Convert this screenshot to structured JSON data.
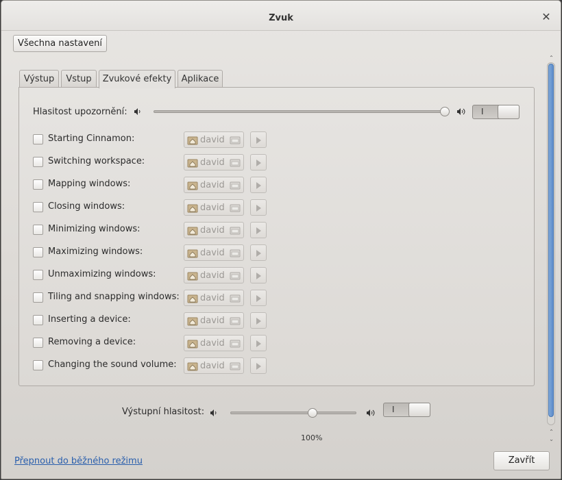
{
  "window": {
    "title": "Zvuk"
  },
  "toolbar": {
    "all_settings_label": "Všechna nastavení"
  },
  "tabs": [
    {
      "label": "Výstup"
    },
    {
      "label": "Vstup"
    },
    {
      "label": "Zvukové efekty"
    },
    {
      "label": "Aplikace"
    }
  ],
  "active_tab": "Zvukové efekty",
  "alert": {
    "label": "Hlasitost upozornění:",
    "level": 1.0,
    "toggle_text": "I",
    "enabled": true
  },
  "effects": [
    {
      "label": "Starting Cinnamon:",
      "file": "david",
      "checked": false
    },
    {
      "label": "Switching workspace:",
      "file": "david",
      "checked": false
    },
    {
      "label": "Mapping windows:",
      "file": "david",
      "checked": false
    },
    {
      "label": "Closing windows:",
      "file": "david",
      "checked": false
    },
    {
      "label": "Minimizing windows:",
      "file": "david",
      "checked": false
    },
    {
      "label": "Maximizing windows:",
      "file": "david",
      "checked": false
    },
    {
      "label": "Unmaximizing windows:",
      "file": "david",
      "checked": false
    },
    {
      "label": "Tiling and snapping windows:",
      "file": "david",
      "checked": false
    },
    {
      "label": "Inserting a device:",
      "file": "david",
      "checked": false
    },
    {
      "label": "Removing a device:",
      "file": "david",
      "checked": false
    },
    {
      "label": "Changing the sound volume:",
      "file": "david",
      "checked": false
    }
  ],
  "output": {
    "label": "Výstupní hlasitost:",
    "level": 0.65,
    "toggle_text": "I",
    "percent": "100%",
    "enabled": true
  },
  "footer": {
    "mode_link": "Přepnout do běžného režimu",
    "close_label": "Zavřít"
  },
  "colors": {
    "link": "#2a5fad",
    "scroll_thumb": "#5c8ccb"
  }
}
